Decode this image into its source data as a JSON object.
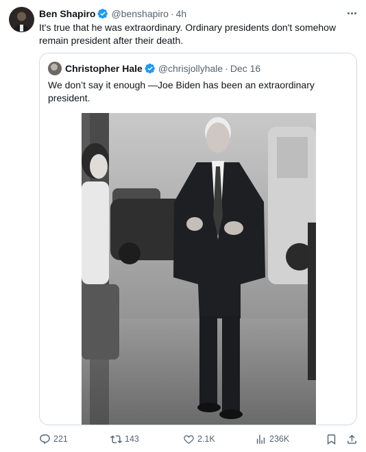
{
  "tweet": {
    "author": {
      "name": "Ben Shapiro",
      "handle": "@benshapiro",
      "separator": "·",
      "time": "4h",
      "avatar_icon": "user-avatar",
      "verified_icon": "verified-badge-icon"
    },
    "text": "It's true that he was extraordinary. Ordinary presidents don't somehow remain president after their death.",
    "quoted": {
      "name": "Christopher Hale",
      "handle": "@chrisjollyhale",
      "separator": "·",
      "date": "Dec 16",
      "text": "We don’t say it enough —Joe Biden has been an extraordinary president.",
      "media": "grayscale-photo"
    },
    "actions": {
      "replies": "221",
      "reposts": "143",
      "likes": "2.1K",
      "views": "236K"
    }
  },
  "colors": {
    "text_primary": "#0f1419",
    "text_secondary": "#536471",
    "verified_blue": "#1d9bf0",
    "border": "#cfd9de"
  }
}
